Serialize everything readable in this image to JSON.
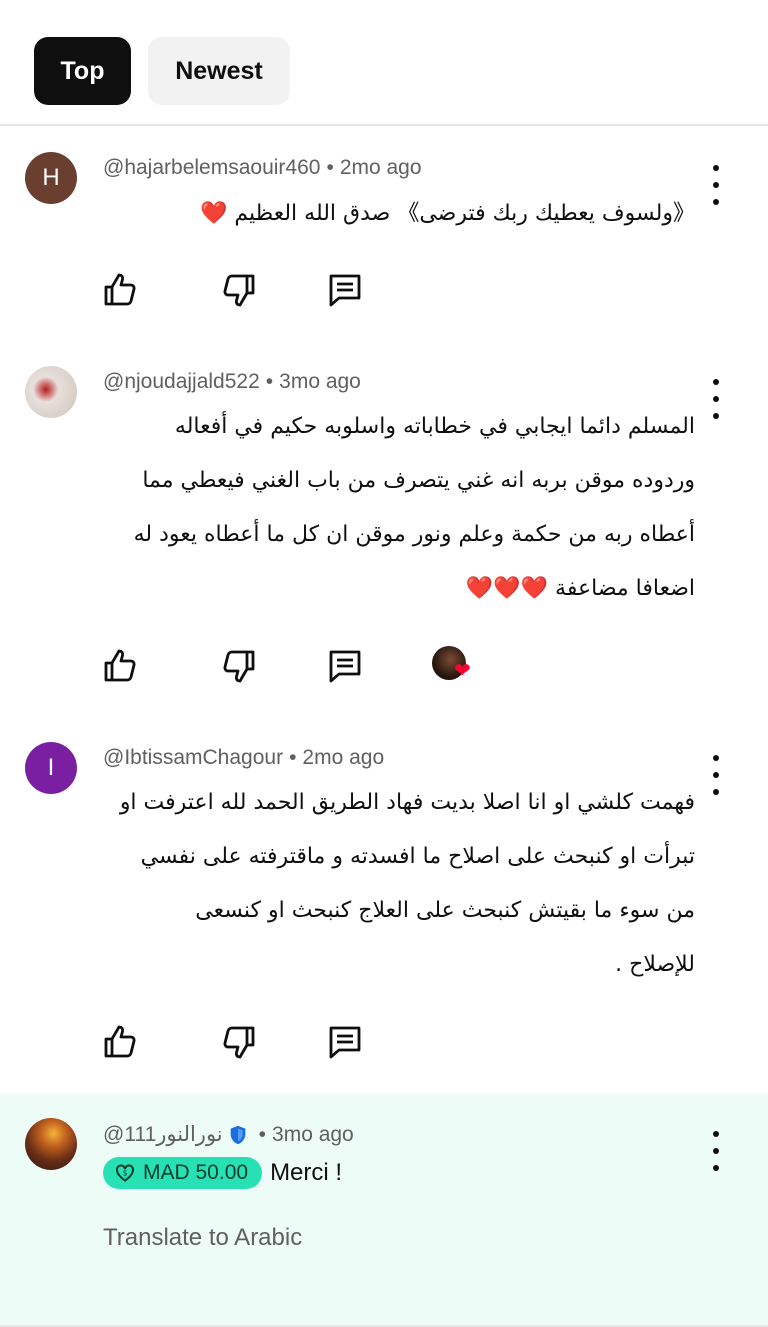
{
  "filters": {
    "top": "Top",
    "newest": "Newest"
  },
  "comments": [
    {
      "avatar_letter": "H",
      "avatar_color": "#6b3f30",
      "author": "@hajarbelemsaouir460",
      "time": "2mo ago",
      "lines": [
        "《ولسوف يعطيك ربك فترضى》 صدق الله العظيم ❤️"
      ]
    },
    {
      "avatar_letter": "",
      "author": "@njoudajjald522",
      "time": "3mo ago",
      "lines": [
        "المسلم دائما ايجابي في خطاباته واسلوبه حكيم في أفعاله",
        "وردوده موقن بربه انه غني يتصرف من باب الغني فيعطي مما",
        "أعطاه ربه من حكمة وعلم ونور موقن ان كل ما أعطاه يعود له",
        "اضعافا مضاعفة ❤️❤️❤️"
      ]
    },
    {
      "avatar_letter": "I",
      "avatar_color": "#7b1fa2",
      "author": "@IbtissamChagour",
      "time": "2mo ago",
      "lines": [
        "فهمت كلشي او انا اصلا بديت فهاد الطريق الحمد لله اعترفت او",
        "تبرأت او كنبحث على اصلاح ما افسدته و ماقترفته على نفسي",
        "من سوء ما بقيتش كنبحث على العلاج كنبحث او كنسعى",
        "للإصلاح ."
      ]
    },
    {
      "author": "@نورالنور111",
      "time": "3mo ago",
      "super_thanks": "MAD 50.00",
      "text": "Merci !",
      "translate": "Translate to Arabic"
    }
  ],
  "separator": "•",
  "colors": {
    "highlight_bg": "#eefcf8",
    "super_thanks": "#27e0b3",
    "heart": "#ff0033"
  }
}
